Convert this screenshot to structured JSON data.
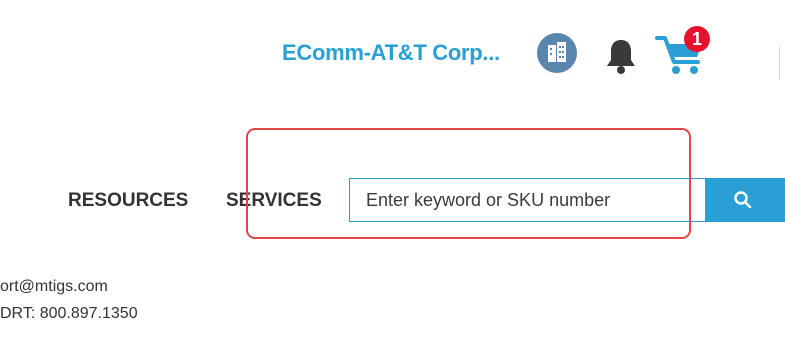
{
  "header": {
    "account_name": "EComm-AT&T Corp...",
    "cart_count": "1"
  },
  "nav": {
    "items": [
      {
        "label": "RESOURCES"
      },
      {
        "label": "SERVICES"
      }
    ]
  },
  "search": {
    "placeholder": "Enter keyword or SKU number",
    "value": ""
  },
  "contact": {
    "email_fragment": "ort@mtigs.com",
    "phone_fragment": "DRT: 800.897.1350"
  },
  "colors": {
    "accent": "#2a9fd6",
    "avatar": "#5a86ad",
    "badge": "#e8112d",
    "highlight": "#e04848",
    "text": "#333333"
  },
  "icons": {
    "org": "building-icon",
    "notifications": "bell-icon",
    "cart": "cart-icon",
    "search": "search-icon"
  }
}
